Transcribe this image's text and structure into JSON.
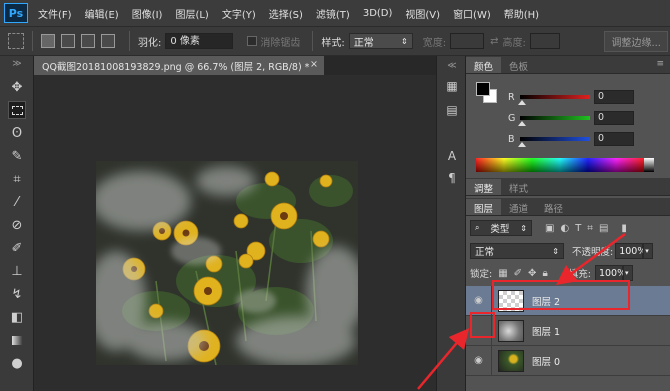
{
  "app": {
    "logo": "Ps"
  },
  "menu": [
    "文件(F)",
    "编辑(E)",
    "图像(I)",
    "图层(L)",
    "文字(Y)",
    "选择(S)",
    "滤镜(T)",
    "3D(D)",
    "视图(V)",
    "窗口(W)",
    "帮助(H)"
  ],
  "options": {
    "feather_label": "羽化:",
    "feather_value": "0 像素",
    "antialias_label": "消除锯齿",
    "style_label": "样式:",
    "style_value": "正常",
    "width_label": "宽度:",
    "height_label": "高度:",
    "refine_label": "调整边缘..."
  },
  "document": {
    "tab_title": "QQ截图20181008193829.png @ 66.7% (图层 2, RGB/8) *",
    "close": "×"
  },
  "color_panel": {
    "tabs": [
      "颜色",
      "色板"
    ],
    "channels": [
      {
        "label": "R",
        "value": "0",
        "color": "#e02020"
      },
      {
        "label": "G",
        "value": "0",
        "color": "#20c020"
      },
      {
        "label": "B",
        "value": "0",
        "color": "#2050e0"
      }
    ],
    "foreground": "#000000",
    "background": "#ffffff"
  },
  "adjust_tabs": [
    "调整",
    "样式"
  ],
  "layers_panel": {
    "tabs": [
      "图层",
      "通道",
      "路径"
    ],
    "filter_label": "类型",
    "blend_mode": "正常",
    "opacity_label": "不透明度:",
    "opacity_value": "100%",
    "lock_label": "锁定:",
    "fill_label": "填充:",
    "fill_value": "100%",
    "layers": [
      {
        "name": "图层 2",
        "visible": true,
        "selected": true
      },
      {
        "name": "图层 1",
        "visible": false,
        "selected": false
      },
      {
        "name": "图层 0",
        "visible": true,
        "selected": false
      }
    ]
  },
  "annotation_color": "#e8262c"
}
